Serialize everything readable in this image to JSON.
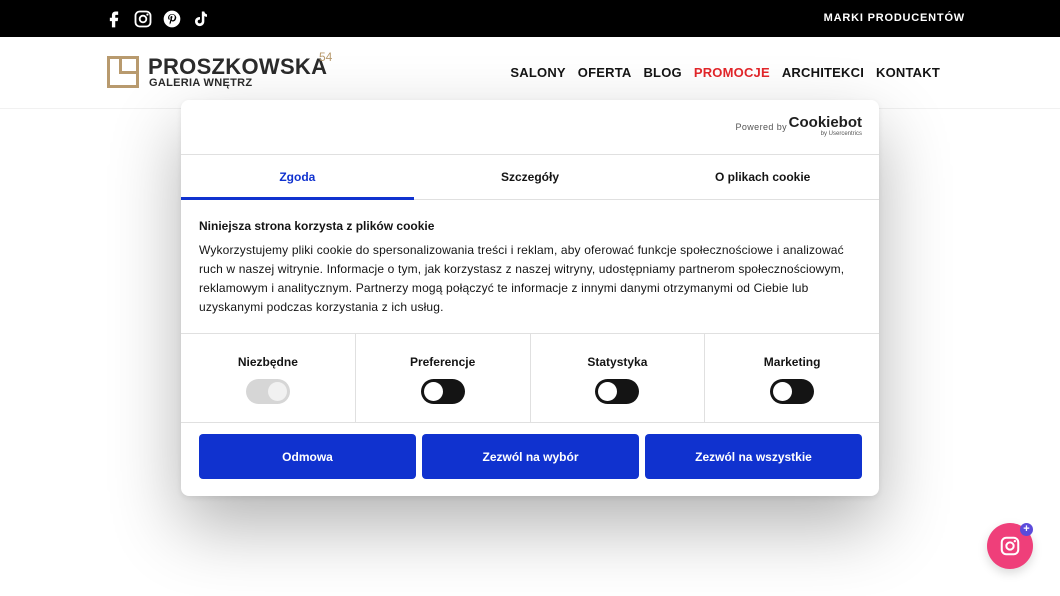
{
  "topbar": {
    "social_icons": [
      "facebook-icon",
      "instagram-icon",
      "pinterest-icon",
      "tiktok-icon"
    ],
    "link": "MARKI PRODUCENTÓW"
  },
  "header": {
    "logo_name": "PROSZKOWSKA",
    "logo_number": "54",
    "logo_subtitle": "GALERIA WNĘTRZ",
    "nav": [
      "SALONY",
      "OFERTA",
      "BLOG",
      "PROMOCJE",
      "ARCHITEKCI",
      "KONTAKT"
    ],
    "accent_color": "#e3262a",
    "logo_color": "#b89a6e"
  },
  "cookie_dialog": {
    "powered_by": "Powered by",
    "brand": "Cookiebot",
    "brand_sub": "by Usercentrics",
    "tabs": [
      "Zgoda",
      "Szczegóły",
      "O plikach cookie"
    ],
    "active_tab": "Zgoda",
    "title": "Niniejsza strona korzysta z plików cookie",
    "text": "Wykorzystujemy pliki cookie do spersonalizowania treści i reklam, aby oferować funkcje społecznościowe i analizować ruch w naszej witrynie. Informacje o tym, jak korzystasz z naszej witryny, udostępniamy partnerom społecznościowym, reklamowym i analitycznym. Partnerzy mogą połączyć te informacje z innymi danymi otrzymanymi od Ciebie lub uzyskanymi podczas korzystania z ich usług.",
    "toggles": [
      {
        "label": "Niezbędne",
        "state": "on-disabled"
      },
      {
        "label": "Preferencje",
        "state": "off"
      },
      {
        "label": "Statystyka",
        "state": "off"
      },
      {
        "label": "Marketing",
        "state": "off"
      }
    ],
    "buttons": [
      "Odmowa",
      "Zezwól na wybór",
      "Zezwól na wszystkie"
    ],
    "primary_color": "#1032cf"
  },
  "floating": {
    "icon": "instagram-icon",
    "badge": "+",
    "color": "#ef3f7a"
  }
}
